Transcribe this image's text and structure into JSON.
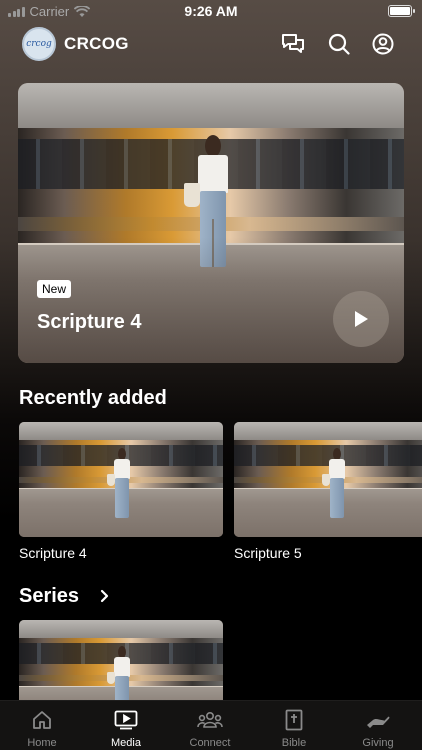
{
  "status_bar": {
    "carrier": "Carrier",
    "time": "9:26 AM"
  },
  "header": {
    "brand": "CRCOG",
    "icons": [
      "chat-icon",
      "search-icon",
      "profile-icon"
    ]
  },
  "featured": {
    "badge": "New",
    "title": "Scripture 4"
  },
  "recently_added": {
    "title": "Recently added",
    "items": [
      {
        "label": "Scripture 4"
      },
      {
        "label": "Scripture 5"
      }
    ]
  },
  "series": {
    "title": "Series"
  },
  "tabs": [
    {
      "label": "Home",
      "icon": "home-icon",
      "active": false
    },
    {
      "label": "Media",
      "icon": "media-icon",
      "active": true
    },
    {
      "label": "Connect",
      "icon": "connect-icon",
      "active": false
    },
    {
      "label": "Bible",
      "icon": "bible-icon",
      "active": false
    },
    {
      "label": "Giving",
      "icon": "giving-icon",
      "active": false
    }
  ],
  "colors": {
    "background": "#000000",
    "header_gradient_top": "#574c45",
    "tab_bar": "#141312",
    "inactive_tab": "#8a8a8a"
  }
}
